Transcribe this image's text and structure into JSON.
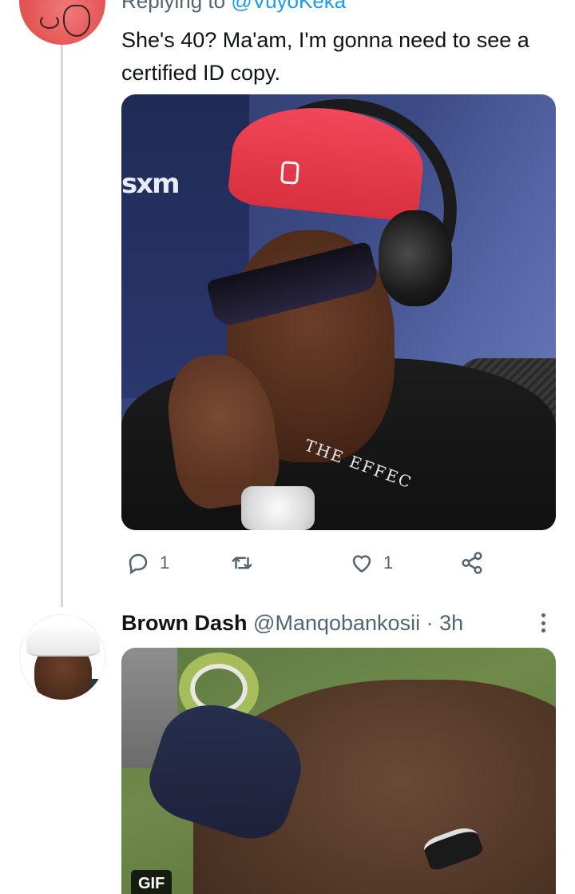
{
  "tweet1": {
    "reply_prefix": "Replying to ",
    "reply_handle": "@VuyoKeka",
    "text": "She's 40? Ma'am, I'm gonna need to see a certified ID copy.",
    "media_alt": "Photo",
    "media_logo": "sxm",
    "shirt_text": "THE EFFEC",
    "actions": {
      "reply_count": "1",
      "retweet_count": "",
      "like_count": "1"
    }
  },
  "tweet2": {
    "name": "Brown Dash",
    "handle": "@Manqobankosii",
    "separator": " · ",
    "time": "3h",
    "media_badge": "GIF"
  },
  "colors": {
    "text_primary": "#0f1419",
    "text_secondary": "#536471",
    "link": "#1d9bf0",
    "thread_line": "#cfd9de"
  },
  "icons": {
    "reply": "reply-icon",
    "retweet": "retweet-icon",
    "like": "heart-icon",
    "share": "share-icon",
    "more": "more-vertical-icon"
  }
}
